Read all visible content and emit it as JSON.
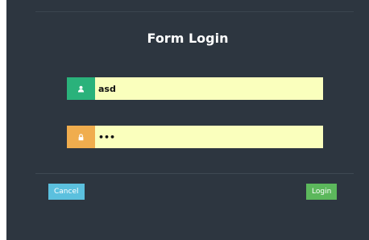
{
  "form": {
    "title": "Form Login",
    "username": {
      "value": "asd",
      "icon": "user-icon",
      "addon_color": "#2ab27b"
    },
    "password": {
      "value": "•••",
      "icon": "lock-icon",
      "addon_color": "#f0ad4e"
    },
    "input_bg": "#faffbd",
    "panel_bg": "#2d3640"
  },
  "actions": {
    "cancel_label": "Cancel",
    "cancel_color": "#5bc0de",
    "login_label": "Login",
    "login_color": "#5cb85c"
  }
}
